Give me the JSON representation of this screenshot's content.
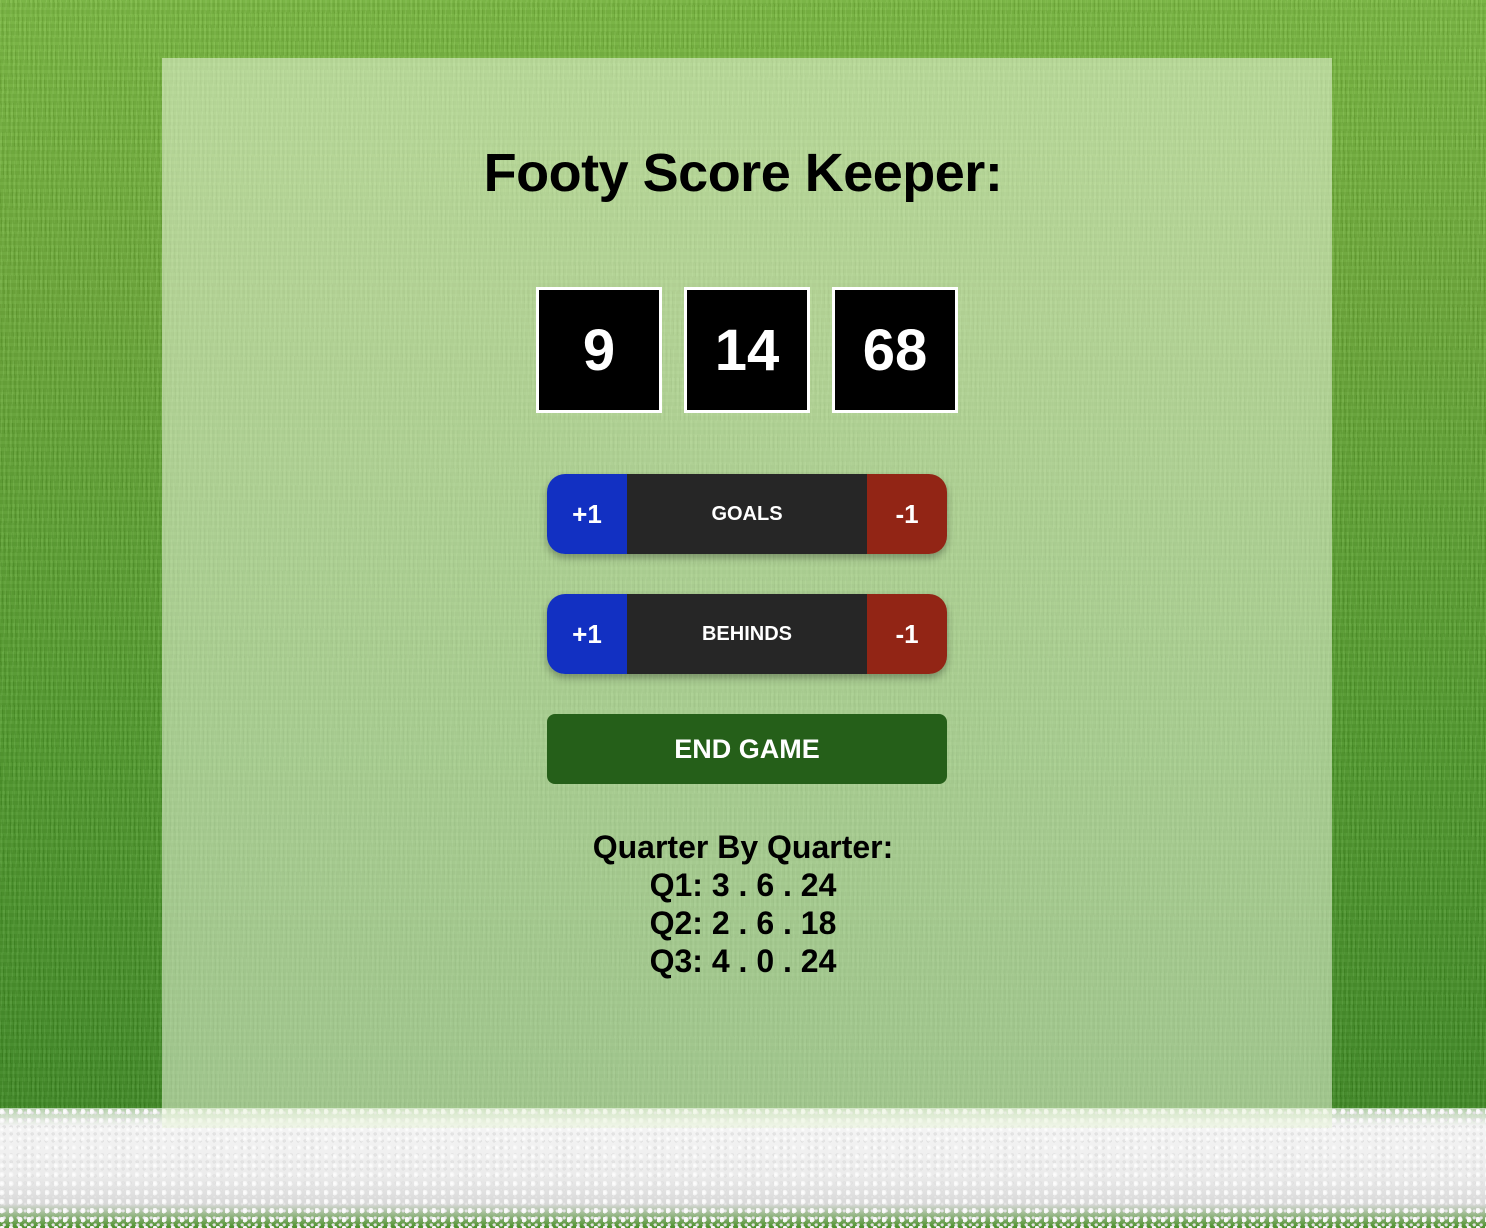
{
  "title": "Footy Score Keeper:",
  "scoreboard": {
    "goals": "9",
    "behinds": "14",
    "total": "68"
  },
  "counters": {
    "goals": {
      "plus": "+1",
      "label": "GOALS",
      "minus": "-1"
    },
    "behinds": {
      "plus": "+1",
      "label": "BEHINDS",
      "minus": "-1"
    }
  },
  "end_game_label": "END GAME",
  "quarters": {
    "heading": "Quarter By Quarter:",
    "items": [
      "Q1: 3 . 6 . 24",
      "Q2: 2 . 6 . 18",
      "Q3: 4 . 0 . 24"
    ]
  },
  "colors": {
    "plus": "#1230c2",
    "minus": "#922515",
    "counter_label": "#262626",
    "end_game": "#255f19",
    "score_box": "#000000"
  }
}
